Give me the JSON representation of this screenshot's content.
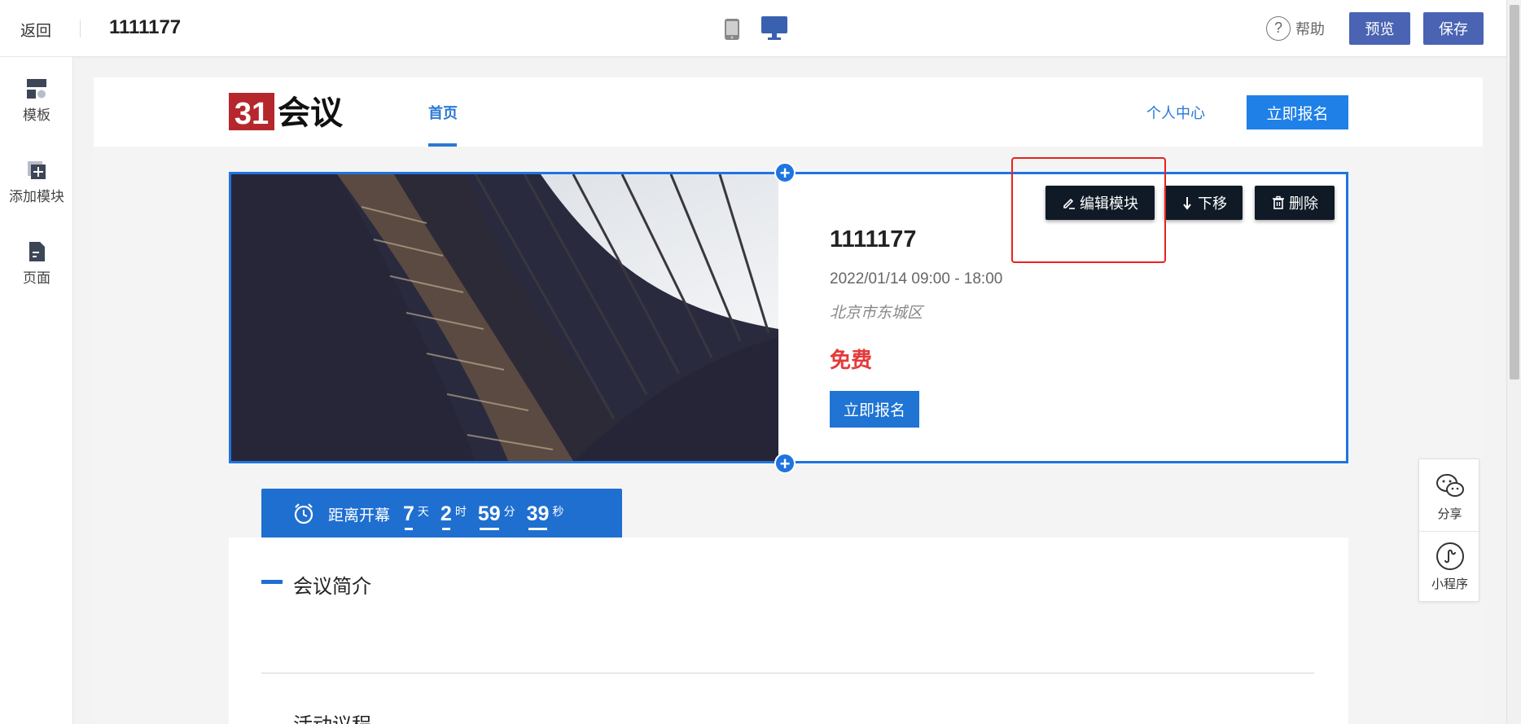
{
  "topbar": {
    "back_label": "返回",
    "title": "1111177",
    "help_label": "帮助",
    "preview_label": "预览",
    "save_label": "保存"
  },
  "sidebar": {
    "items": [
      {
        "label": "模板",
        "icon": "template-icon"
      },
      {
        "label": "添加模块",
        "icon": "add-module-icon"
      },
      {
        "label": "页面",
        "icon": "page-icon"
      }
    ]
  },
  "site": {
    "logo_text": "31会议",
    "nav_home": "首页",
    "nav_personal": "个人中心",
    "nav_register": "立即报名"
  },
  "event": {
    "title": "1111177",
    "time": "2022/01/14 09:00 - 18:00",
    "location": "北京市东城区",
    "price": "免费",
    "register_label": "立即报名"
  },
  "toolbar": {
    "edit_label": "编辑模块",
    "move_down_label": "下移",
    "delete_label": "删除"
  },
  "countdown": {
    "label": "距离开幕",
    "days": "7",
    "days_unit": "天",
    "hours": "2",
    "hours_unit": "时",
    "minutes": "59",
    "minutes_unit": "分",
    "seconds": "39",
    "seconds_unit": "秒"
  },
  "intro": {
    "title": "会议简介",
    "next_title": "活动议程"
  },
  "float_panel": {
    "share_label": "分享",
    "mini_label": "小程序"
  },
  "colors": {
    "accent": "#1f74e0",
    "topbar_button": "#4a63b3",
    "price_red": "#e43a3a",
    "toolbar_dark": "#0f1a26",
    "highlight_red": "#e8231f"
  }
}
